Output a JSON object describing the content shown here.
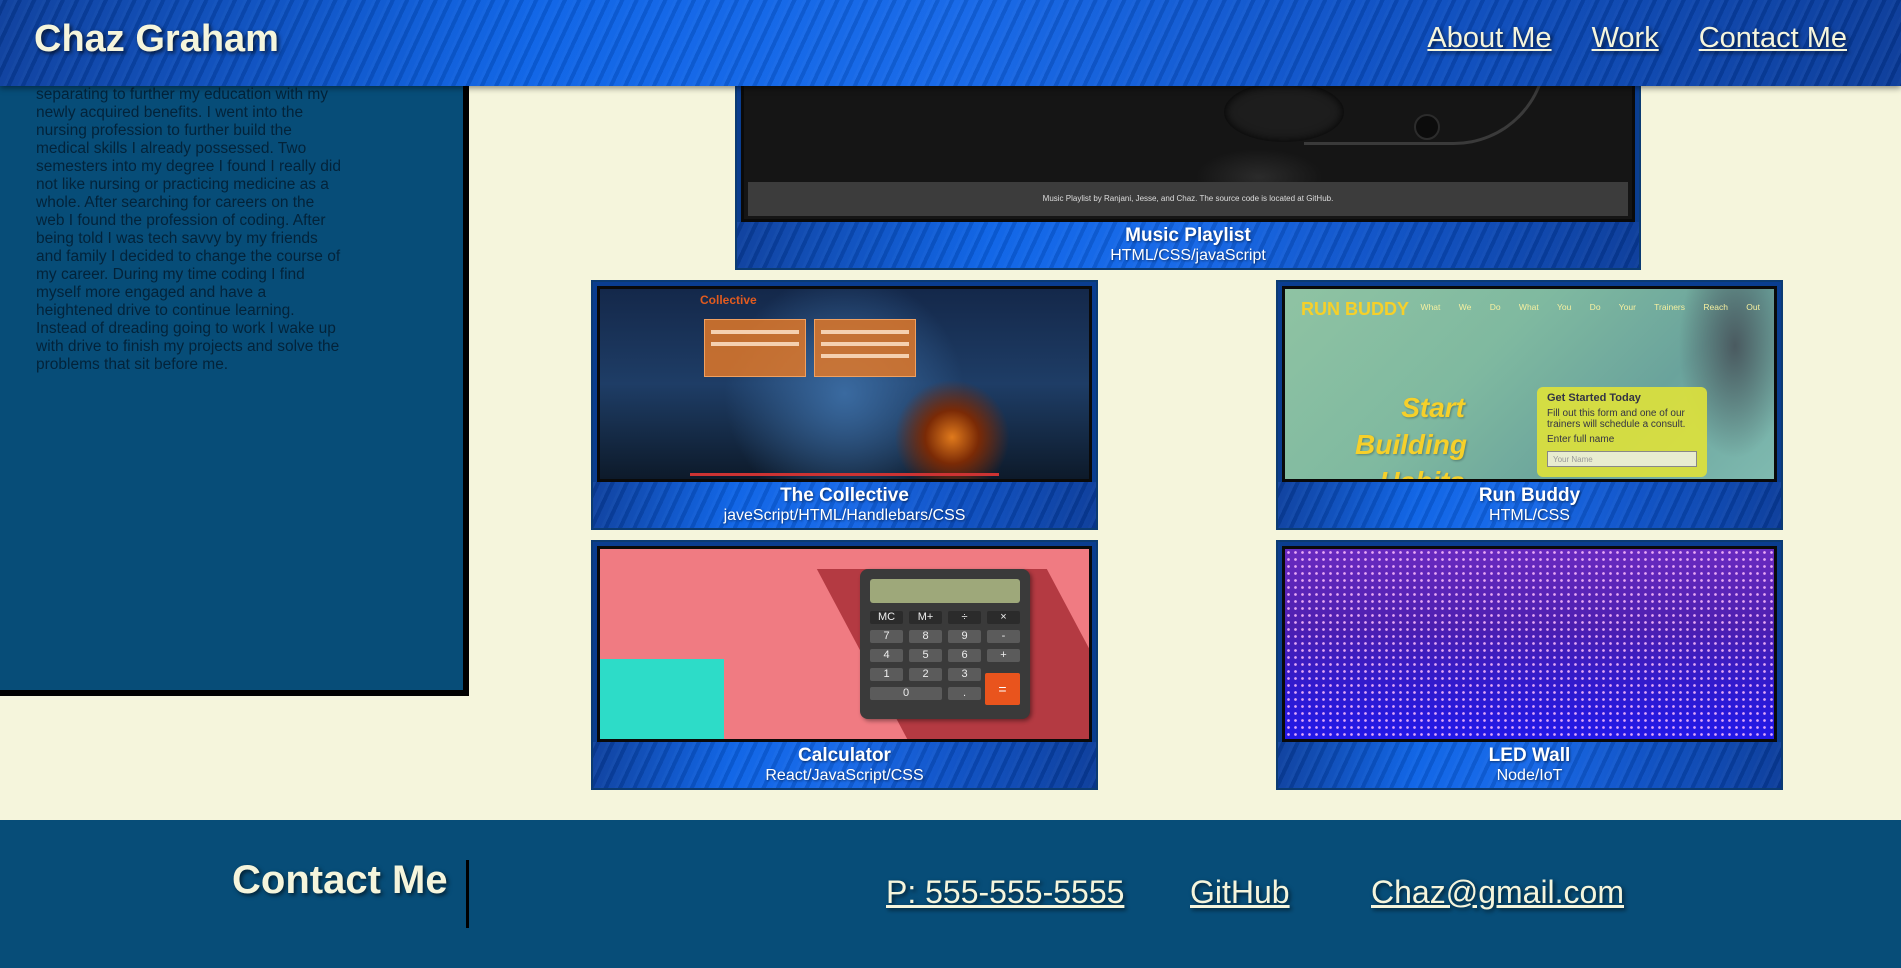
{
  "header": {
    "brand": "Chaz Graham",
    "nav": [
      "About Me",
      "Work",
      "Contact Me"
    ]
  },
  "about": {
    "text": "separating to further my education with my newly acquired benefits. I went into the nursing profession to further build the medical skills I already possessed. Two semesters into my degree I found I really did not like nursing or practicing medicine as a whole. After searching for careers on the web I found the profession of coding. After being told I was tech savvy by my friends and family I decided to change the course of my career. During my time coding I find myself more engaged and have a heightened drive to continue learning. Instead of dreading going to work I wake up with drive to finish my projects and solve the problems that sit before me."
  },
  "projects": [
    {
      "title": "Music Playlist",
      "subtitle": "HTML/CSS/javaScript",
      "screenshot_text": "Music Playlist by Ranjani, Jesse, and Chaz. The source code is located at GitHub."
    },
    {
      "title": "The Collective",
      "subtitle": "javeScript/HTML/Handlebars/CSS",
      "screenshot_text": "Collective"
    },
    {
      "title": "Run Buddy",
      "subtitle": "HTML/CSS",
      "screenshot_text": {
        "logo": "RUN BUDDY",
        "nav": "What We Do What You Do Your Trainers Reach Out",
        "hero": "Start Building Habits",
        "box_title": "Get Started Today",
        "box_text": "Fill out this form and one of our trainers will schedule a consult.",
        "box_label": "Enter full name",
        "box_placeholder": "Your Name"
      }
    },
    {
      "title": "Calculator",
      "subtitle": "React/JavaScript/CSS",
      "screenshot_text": {
        "keys": [
          [
            "MC",
            "M+",
            "÷",
            "×"
          ],
          [
            "7",
            "8",
            "9",
            "-"
          ],
          [
            "4",
            "5",
            "6",
            "+"
          ],
          [
            "1",
            "2",
            "3"
          ],
          [
            "0",
            "."
          ]
        ],
        "equals": "="
      }
    },
    {
      "title": "LED Wall",
      "subtitle": "Node/IoT"
    }
  ],
  "footer": {
    "title": "Contact Me",
    "phone": "P: 555-555-5555",
    "github": "GitHub",
    "email": "Chaz@gmail.com"
  }
}
